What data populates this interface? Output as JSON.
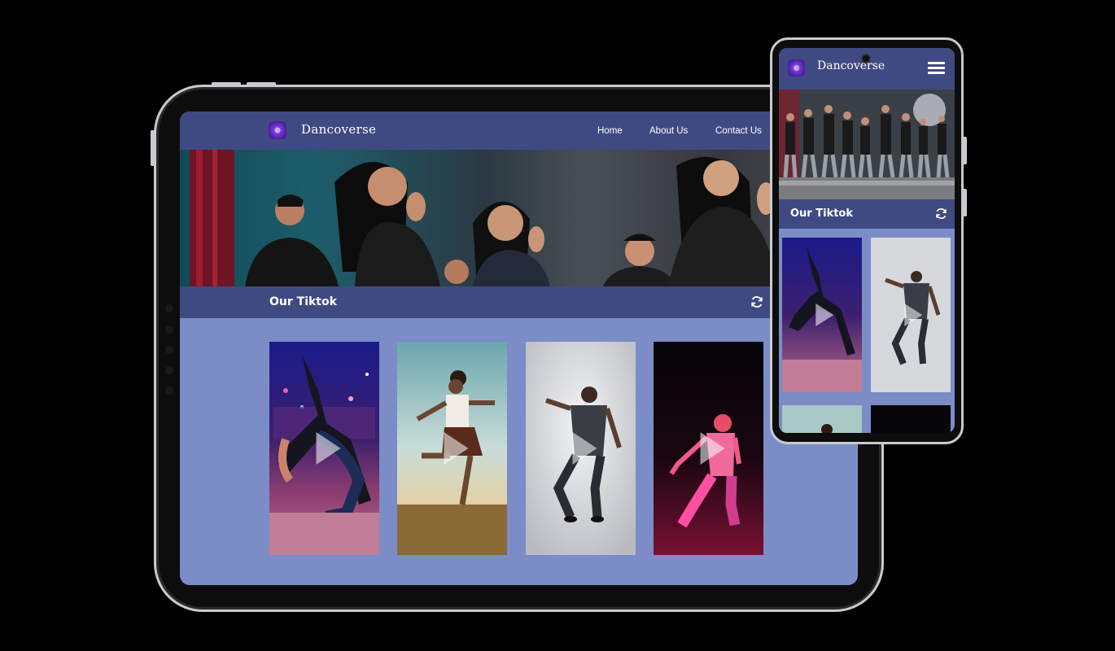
{
  "app": {
    "brand": "Dancoverse"
  },
  "nav": [
    {
      "label": "Home"
    },
    {
      "label": "About Us"
    },
    {
      "label": "Contact Us"
    }
  ],
  "section": {
    "title": "Our Tiktok",
    "refresh_icon": "refresh-icon"
  },
  "cards": [
    {
      "name": "dancer-night-backbend",
      "icon": "play-icon"
    },
    {
      "name": "dancer-jumping-sky",
      "icon": "play-icon"
    },
    {
      "name": "dancer-studio-grey",
      "icon": "play-icon"
    },
    {
      "name": "dancer-neon-pink",
      "icon": "play-icon"
    }
  ],
  "mobile": {
    "brand": "Dancoverse",
    "menu_icon": "hamburger-icon",
    "section_title": "Our Tiktok"
  },
  "colors": {
    "header": "#3f4a83",
    "content_bg": "#7b8cc6",
    "frame": "#c9cace"
  }
}
